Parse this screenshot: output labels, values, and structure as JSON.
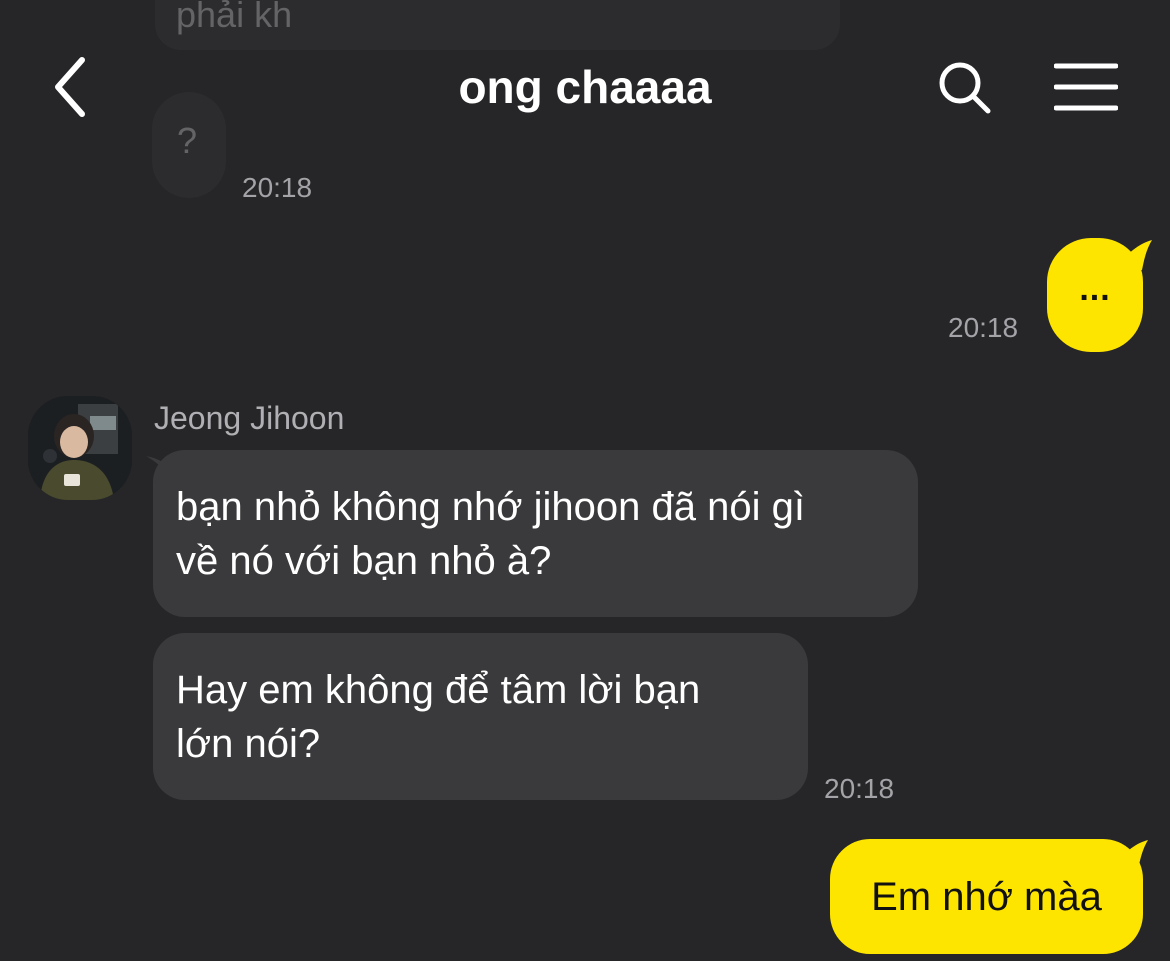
{
  "header": {
    "title": "ong chaaaa"
  },
  "ghost": {
    "text1": "phải kh",
    "text2": "?"
  },
  "messages": {
    "time_top": "20:18",
    "out1": {
      "text": "...",
      "time": "20:18"
    },
    "sender_name": "Jeong Jihoon",
    "in1": {
      "line1": "bạn nhỏ không nhớ jihoon đã nói gì",
      "line2": "về nó với bạn nhỏ à?"
    },
    "in2": {
      "line1": "Hay em không để tâm lời bạn",
      "line2": "lớn nói?",
      "time": "20:18"
    },
    "out2": {
      "text": "Em nhớ màa"
    }
  },
  "colors": {
    "background": "#262628",
    "incoming_bubble": "#3a3a3c",
    "outgoing_bubble": "#fee500",
    "timestamp": "#a3a3a8"
  },
  "icons": {
    "back": "chevron-left-icon",
    "search": "search-icon",
    "menu": "hamburger-menu-icon"
  }
}
